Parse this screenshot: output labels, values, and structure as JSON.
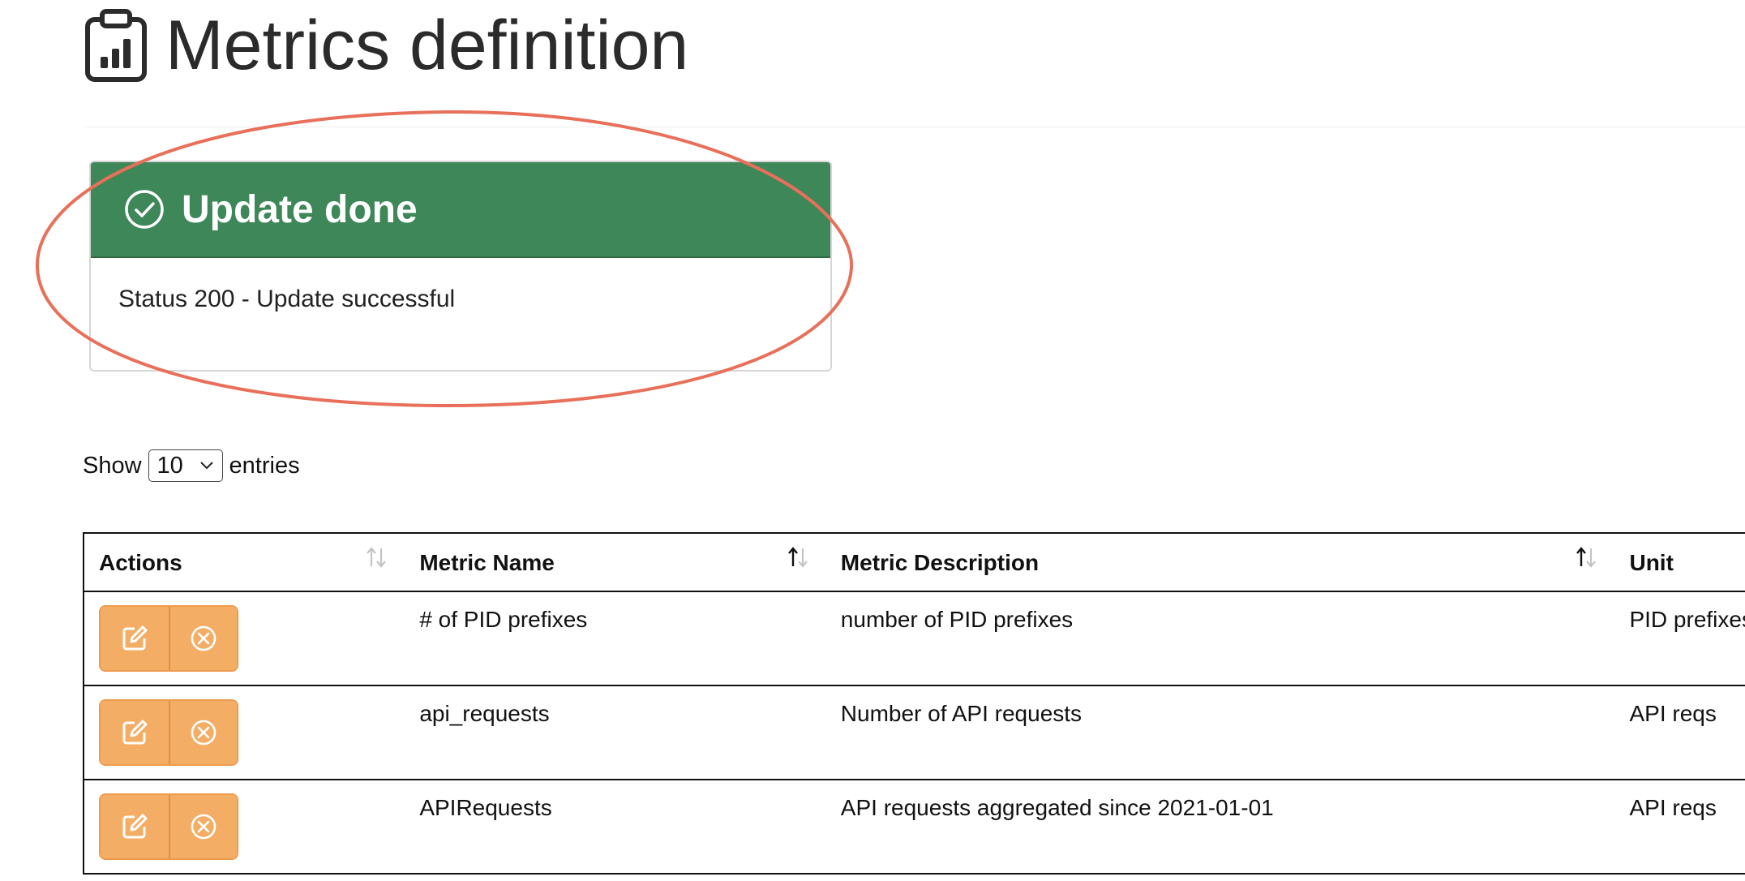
{
  "header": {
    "title": "Metrics definition",
    "icon": "clipboard-chart-icon"
  },
  "alert": {
    "title": "Update done",
    "message": "Status 200 - Update successful",
    "icon": "check-circle-icon",
    "color": "#3e8758"
  },
  "length_menu": {
    "prefix": "Show",
    "value": "10",
    "suffix": "entries"
  },
  "table": {
    "columns": [
      "Actions",
      "Metric Name",
      "Metric Description",
      "Unit"
    ],
    "rows": [
      {
        "name": "# of PID prefixes",
        "description": "number of PID prefixes",
        "unit": "PID prefixes"
      },
      {
        "name": "api_requests",
        "description": "Number of API requests",
        "unit": "API reqs"
      },
      {
        "name": "APIRequests",
        "description": "API requests aggregated since 2021-01-01",
        "unit": "API reqs"
      }
    ],
    "action_color": "#f4ad65"
  }
}
